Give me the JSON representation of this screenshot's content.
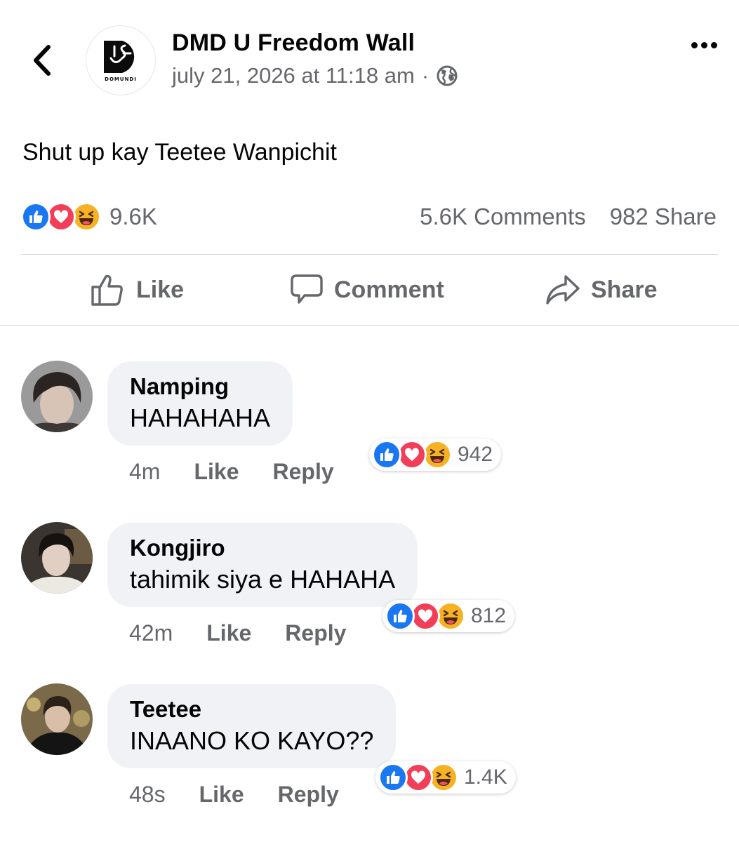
{
  "header": {
    "back_icon": "chevron-left-icon",
    "page_name": "DMD U Freedom Wall",
    "timestamp": "july 21, 2026 at 11:18 am",
    "separator": "·",
    "privacy_icon": "globe-icon",
    "more_icon": "more-horizontal-icon",
    "logo_text": "DOMUNDI"
  },
  "post": {
    "text": "Shut up kay Teetee Wanpichit"
  },
  "summary": {
    "reaction_icons": [
      "like-icon",
      "love-icon",
      "haha-icon"
    ],
    "reaction_count": "9.6K",
    "comments": "5.6K Comments",
    "shares": "982 Share"
  },
  "actions": {
    "like": "Like",
    "comment": "Comment",
    "share": "Share"
  },
  "comments": [
    {
      "author": "Namping",
      "text": "HAHAHAHA",
      "time": "4m",
      "like": "Like",
      "reply": "Reply",
      "reactions": "942"
    },
    {
      "author": "Kongjiro",
      "text": "tahimik siya e HAHAHA",
      "time": "42m",
      "like": "Like",
      "reply": "Reply",
      "reactions": "812"
    },
    {
      "author": "Teetee",
      "text": "INAANO KO KAYO??",
      "time": "48s",
      "like": "Like",
      "reply": "Reply",
      "reactions": "1.4K"
    }
  ],
  "colors": {
    "like_blue": "#1a77f2",
    "love_red": "#f33e58",
    "haha_yellow": "#f7b125",
    "bubble_bg": "#f0f2f5",
    "secondary_text": "#65676b"
  }
}
